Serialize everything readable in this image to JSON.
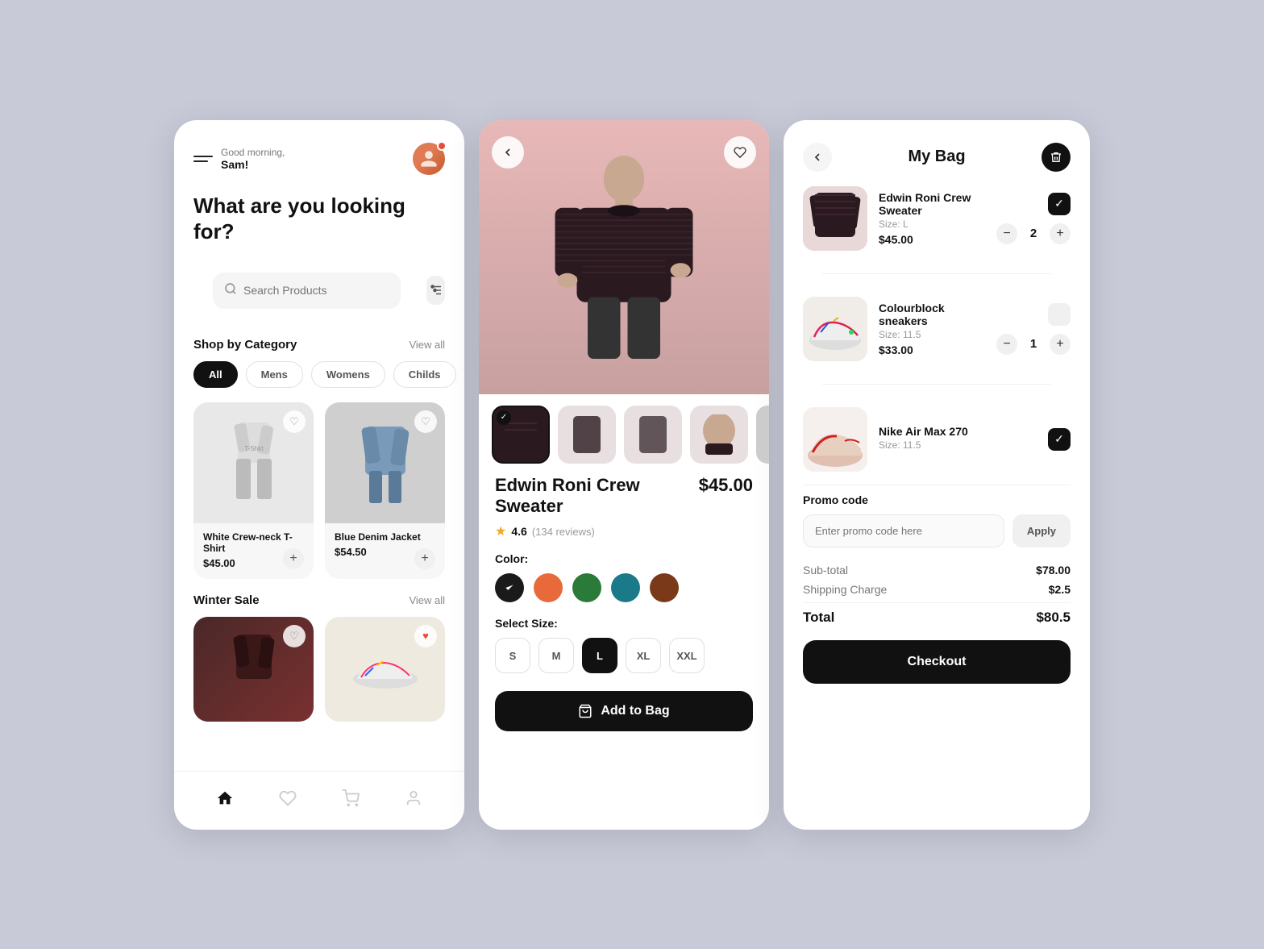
{
  "screen1": {
    "greeting_top": "Good morning,",
    "greeting_name": "Sam!",
    "headline": "What are you looking for?",
    "search_placeholder": "Search Products",
    "category_label": "Shop by Category",
    "view_all": "View all",
    "categories": [
      "All",
      "Mens",
      "Womens",
      "Childs"
    ],
    "active_category": "All",
    "products": [
      {
        "name": "White Crew-neck T-Shirt",
        "price": "$45.00"
      },
      {
        "name": "Blue Denim Jacket",
        "price": "$54.50"
      }
    ],
    "sale_label": "Winter Sale",
    "sale_view_all": "View all"
  },
  "screen2": {
    "product_title": "Edwin Roni Crew Sweater",
    "price": "$45.00",
    "rating": "4.6",
    "review_count": "(134 reviews)",
    "color_label": "Color:",
    "colors": [
      "#1a1a1a",
      "#e86a3a",
      "#2a7a3a",
      "#1a7a8a",
      "#7a3a1a"
    ],
    "size_label": "Select Size:",
    "sizes": [
      "S",
      "M",
      "L",
      "XL",
      "XXL"
    ],
    "active_size": "L",
    "add_to_bag": "Add to Bag"
  },
  "screen3": {
    "title": "My Bag",
    "items": [
      {
        "name": "Edwin Roni Crew Sweater",
        "size": "Size: L",
        "price": "$45.00",
        "qty": "2",
        "checked": true
      },
      {
        "name": "Colourblock sneakers",
        "size": "Size: 11.5",
        "price": "$33.00",
        "qty": "1",
        "checked": false
      },
      {
        "name": "Nike Air Max 270",
        "size": "Size: 11.5",
        "price": "",
        "qty": "",
        "checked": true
      }
    ],
    "promo_label": "Promo code",
    "promo_placeholder": "Enter promo code here",
    "promo_apply": "Apply",
    "subtotal_label": "Sub-total",
    "subtotal_val": "$78.00",
    "shipping_label": "Shipping Charge",
    "shipping_val": "$2.5",
    "total_label": "Total",
    "total_val": "$80.5",
    "checkout_label": "Checkout"
  },
  "icons": {
    "back": "←",
    "heart_empty": "♡",
    "heart_filled": "♥",
    "check": "✓",
    "plus": "+",
    "minus": "−",
    "trash": "🗑",
    "bag": "🛍",
    "home": "⌂",
    "user": "👤",
    "cart": "🛒",
    "search": "⌕",
    "filter": "⊟",
    "star": "★"
  }
}
